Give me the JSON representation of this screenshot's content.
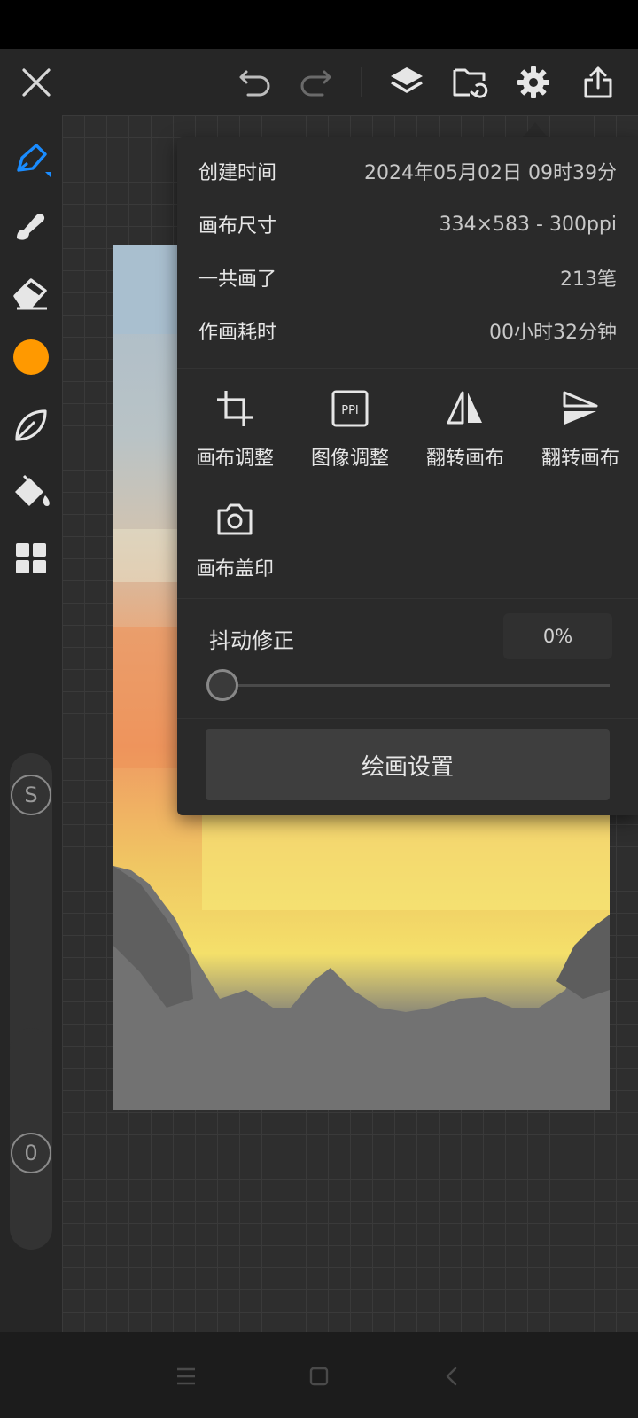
{
  "toolbar": {
    "close_icon": "close-icon",
    "undo_icon": "undo-icon",
    "redo_icon": "redo-icon",
    "layers_icon": "layers-icon",
    "folder_icon": "folder-sync-icon",
    "settings_icon": "gear-icon",
    "share_icon": "share-icon"
  },
  "sidebar": {
    "tools": [
      "pen-tool-icon",
      "smudge-icon",
      "eraser-icon",
      "color-picker",
      "leaf-brush-icon",
      "fill-bucket-icon",
      "grid-menu-icon"
    ],
    "active_color": "#ff9900",
    "size_knob_label": "S",
    "opacity_knob_label": "0"
  },
  "canvas_info": {
    "rows": [
      {
        "label": "创建时间",
        "value": "2024年05月02日 09时39分"
      },
      {
        "label": "画布尺寸",
        "value": "334×583 - 300ppi"
      },
      {
        "label": "一共画了",
        "value": "213笔"
      },
      {
        "label": "作画耗时",
        "value": "00小时32分钟"
      }
    ]
  },
  "canvas_tools": [
    {
      "label": "画布调整",
      "icon": "crop-icon"
    },
    {
      "label": "图像调整",
      "icon": "ppi-icon",
      "icon_text": "PPI"
    },
    {
      "label": "翻转画布",
      "icon": "flip-horizontal-icon"
    },
    {
      "label": "翻转画布",
      "icon": "flip-vertical-icon"
    },
    {
      "label": "画布盖印",
      "icon": "camera-icon"
    }
  ],
  "stabilizer": {
    "label": "抖动修正",
    "value": "0%",
    "level": 0
  },
  "drawing_settings_label": "绘画设置",
  "nav": {
    "menu_icon": "menu-icon",
    "home_icon": "home-icon",
    "back_icon": "back-icon"
  },
  "colors": {
    "accent_blue": "#1a8cff",
    "orange": "#ff9900",
    "panel": "#2a2a2a"
  }
}
